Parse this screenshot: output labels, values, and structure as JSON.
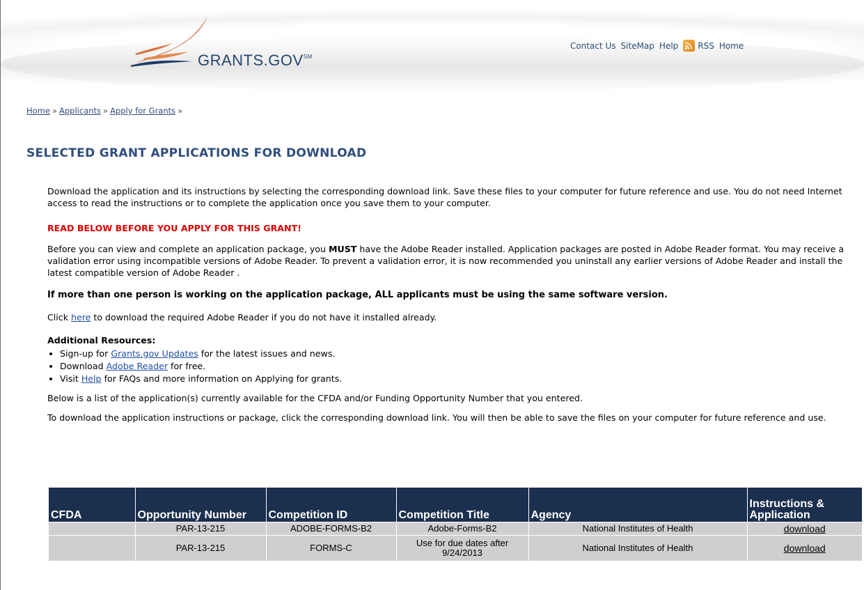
{
  "header": {
    "logo_text": "GRANTS.GOV",
    "logo_mark": "SM",
    "links": [
      "Contact Us",
      "SiteMap",
      "Help"
    ],
    "rss_label": "RSS",
    "home_label": "Home"
  },
  "breadcrumb": [
    "Home",
    "Applicants",
    "Apply for Grants"
  ],
  "breadcrumb_sep": "»",
  "page_title": "SELECTED GRANT APPLICATIONS FOR DOWNLOAD",
  "intro": "Download the application and its instructions by selecting the corresponding download link. Save these files to your computer for future reference and use. You do not need Internet access to read the instructions or to complete the application once you save them to your computer.",
  "warning": "READ BELOW BEFORE YOU APPLY FOR THIS GRANT!",
  "adobe_para": {
    "before": "Before you can view and complete an application package, you ",
    "must": "MUST",
    "after": " have the Adobe Reader installed. Application packages are posted in Adobe Reader format. You may receive a validation error using incompatible versions of Adobe Reader. To prevent a validation error, it is now recommended you uninstall any earlier versions of Adobe Reader and install the latest compatible version of Adobe Reader ."
  },
  "same_version": "If more than one person is working on the application package, ALL applicants must be using the same software version.",
  "click_here": {
    "before": "Click ",
    "link": "here",
    "after": " to download the required Adobe Reader if you do not have it installed already."
  },
  "additional_resources": {
    "title": "Additional Resources:",
    "items": [
      {
        "before": "Sign-up for ",
        "link": "Grants.gov Updates",
        "after": " for the latest issues and news."
      },
      {
        "before": "Download ",
        "link": "Adobe Reader",
        "after": " for free."
      },
      {
        "before": "Visit ",
        "link": "Help",
        "after": " for FAQs and more information on Applying for grants."
      }
    ]
  },
  "below_list": "Below is a list of the application(s) currently available for the CFDA and/or Funding Opportunity Number that you entered.",
  "to_download": "To download the application instructions or package, click the corresponding download link. You will then be able to save the files on your computer for future reference and use.",
  "table": {
    "headers": [
      "CFDA",
      "Opportunity Number",
      "Competition ID",
      "Competition Title",
      "Agency",
      "Instructions & Application"
    ],
    "rows": [
      {
        "cfda": "",
        "opportunity": "PAR-13-215",
        "competition_id": "ADOBE-FORMS-B2",
        "competition_title": "Adobe-Forms-B2",
        "agency": "National Institutes of Health",
        "link": "download"
      },
      {
        "cfda": "",
        "opportunity": "PAR-13-215",
        "competition_id": "FORMS-C",
        "competition_title": "Use for due dates after 9/24/2013",
        "agency": "National Institutes of Health",
        "link": "download"
      }
    ]
  }
}
